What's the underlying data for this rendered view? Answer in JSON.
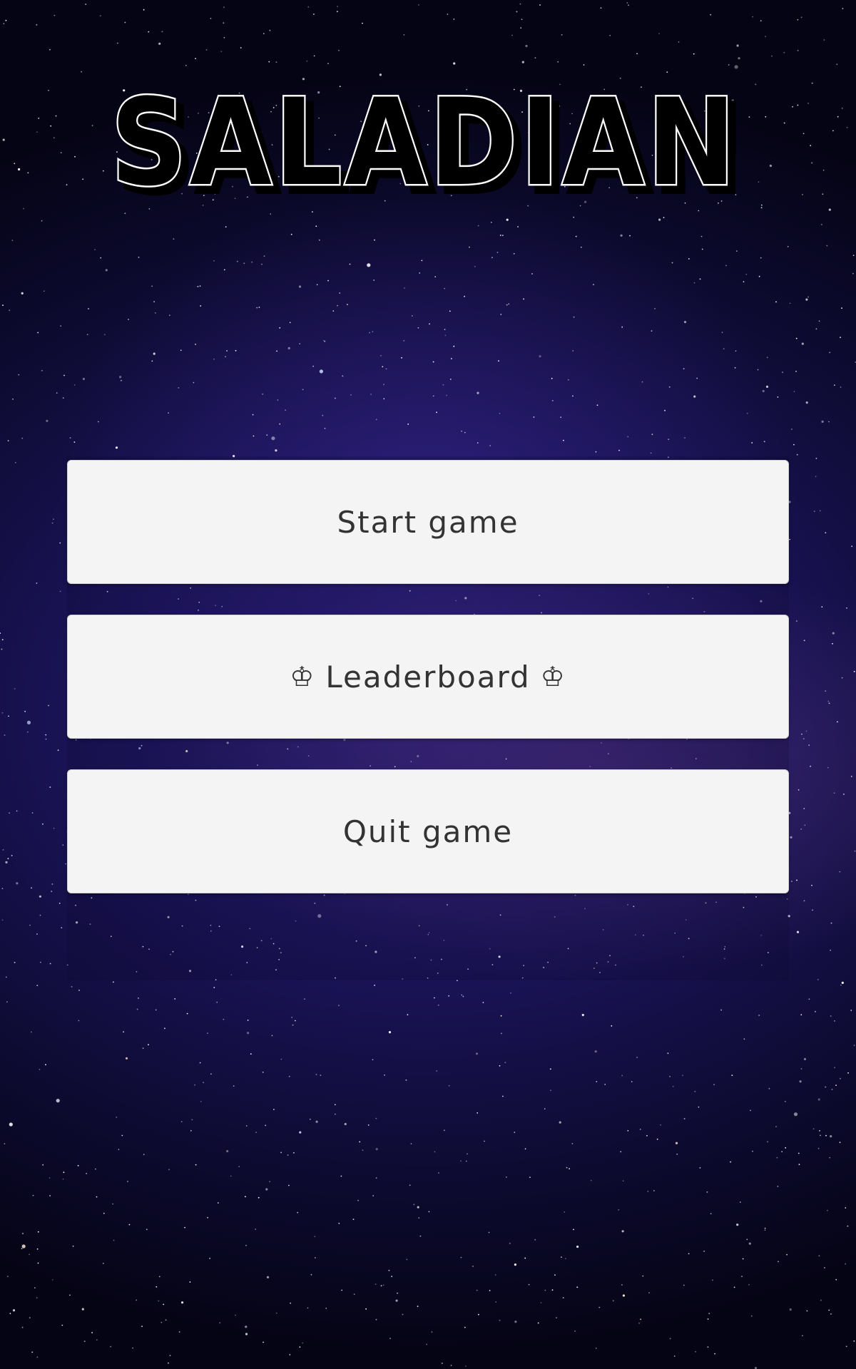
{
  "game": {
    "title": "SALADIAN"
  },
  "menu": {
    "start_label": "Start game",
    "leaderboard_label": "Leaderboard",
    "leaderboard_icon": "♔",
    "quit_label": "Quit game"
  },
  "colors": {
    "button_bg": "#f4f4f4",
    "button_text": "#333333",
    "title_fill": "#000000",
    "title_outline": "#ffffff"
  }
}
